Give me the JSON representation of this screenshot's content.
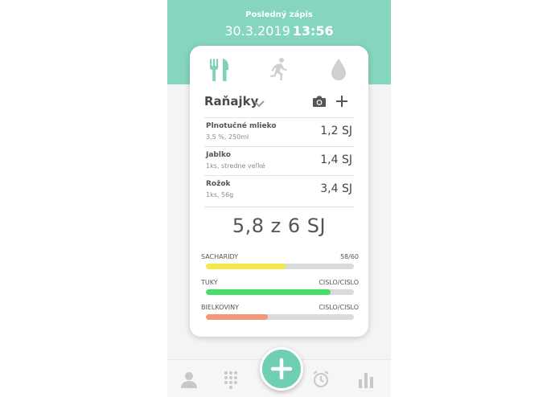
{
  "header": {
    "label": "Posledný zápis",
    "date": "30.3.2019",
    "time": "13:56"
  },
  "category_icons": [
    "fork-knife-icon",
    "running-icon",
    "drop-icon"
  ],
  "meal": {
    "name": "Raňajky",
    "icons": [
      "chevron-down-icon",
      "camera-icon",
      "plus-icon"
    ]
  },
  "items": [
    {
      "name": "Plnotučné mlieko",
      "detail": "3,5 %, 250ml",
      "value": "1,2 SJ"
    },
    {
      "name": "Jablko",
      "detail": "1ks, stredne veľké",
      "value": "1,4 SJ"
    },
    {
      "name": "Rožok",
      "detail": "1ks, 56g",
      "value": "3,4 SJ"
    }
  ],
  "total": "5,8 z 6 SJ",
  "nutrients": [
    {
      "label": "SACHARIDY",
      "value": "58/60",
      "fraction": 0.54,
      "color": "#f2e84b"
    },
    {
      "label": "TUKY",
      "value": "CISLO/CISLO",
      "fraction": 0.84,
      "color": "#47e066"
    },
    {
      "label": "BIELKOVINY",
      "value": "CISLO/CISLO",
      "fraction": 0.42,
      "color": "#f2977a"
    }
  ],
  "colors": {
    "accent": "#85d5bf",
    "fab": "#6fcfb3",
    "icon_active": "#7fd1b9",
    "icon_inactive": "#d0d0d0"
  },
  "bottom_nav": [
    "user-icon",
    "keypad-icon",
    "add-icon",
    "alarm-clock-icon",
    "bar-chart-icon"
  ]
}
